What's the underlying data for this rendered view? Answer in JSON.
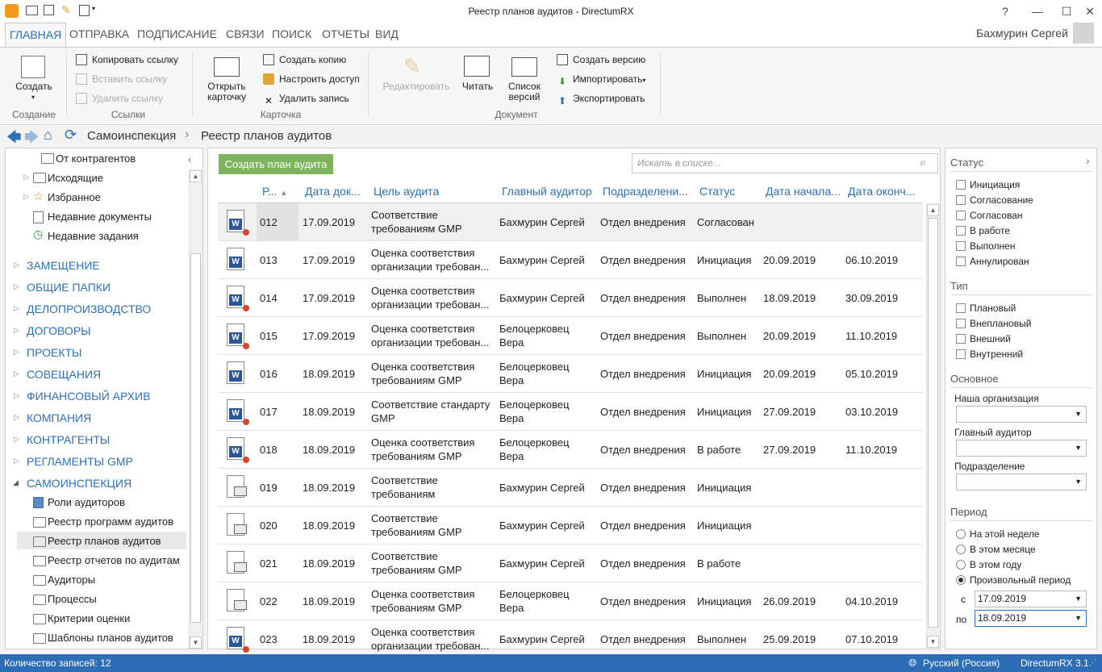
{
  "window": {
    "title": "Реестр планов аудитов - DirectumRX",
    "help": "?",
    "minimize": "—",
    "maximize": "☐",
    "close": "✕"
  },
  "tabs": [
    "ГЛАВНАЯ",
    "ОТПРАВКА",
    "ПОДПИСАНИЕ",
    "СВЯЗИ",
    "ПОИСК",
    "ОТЧЕТЫ",
    "ВИД"
  ],
  "user": "Бахмурин Сергей",
  "ribbon": {
    "create": "Создать",
    "copy_link": "Копировать ссылку",
    "paste_link": "Вставить ссылку",
    "delete_link": "Удалить ссылку",
    "open_card_1": "Открыть",
    "open_card_2": "карточку",
    "create_copy": "Создать копию",
    "setup_access": "Настроить доступ",
    "delete_record": "Удалить запись",
    "edit": "Редактировать",
    "read": "Читать",
    "versions_1": "Список",
    "versions_2": "версий",
    "create_version": "Создать версию",
    "import": "Импортировать",
    "export": "Экспортировать",
    "groups": {
      "creation": "Создание",
      "links": "Ссылки",
      "card": "Карточка",
      "document": "Документ"
    }
  },
  "breadcrumb": {
    "root": "Самоинспекция",
    "sep": "›",
    "current": "Реестр планов аудитов"
  },
  "left": {
    "items_top": [
      "От контрагентов",
      "Исходящие",
      "Избранное",
      "Недавние документы",
      "Недавние задания"
    ],
    "sections": [
      "ЗАМЕЩЕНИЕ",
      "ОБЩИЕ ПАПКИ",
      "ДЕЛОПРОИЗВОДСТВО",
      "ДОГОВОРЫ",
      "ПРОЕКТЫ",
      "СОВЕЩАНИЯ",
      "ФИНАНСОВЫЙ АРХИВ",
      "КОМПАНИЯ",
      "КОНТРАГЕНТЫ",
      "РЕГЛАМЕНТЫ GMP",
      "САМОИНСПЕКЦИЯ"
    ],
    "sub": [
      "Роли аудиторов",
      "Реестр программ аудитов",
      "Реестр планов аудитов",
      "Реестр отчетов по аудитам",
      "Аудиторы",
      "Процессы",
      "Критерии оценки",
      "Шаблоны планов аудитов"
    ]
  },
  "toolbar": {
    "create_plan": "Создать план аудита",
    "search_placeholder": "Искать в списке..."
  },
  "columns": [
    "Р...",
    "Дата док...",
    "Цель аудита",
    "Главный аудитор",
    "Подразделени...",
    "Статус",
    "Дата начала...",
    "Дата оконч..."
  ],
  "rows": [
    {
      "num": "012",
      "date": "17.09.2019",
      "goal1": "Соответствие",
      "goal2": "требованиям GMP",
      "aud1": "Бахмурин Сергей",
      "aud2": "",
      "dept": "Отдел внедрения",
      "status": "Согласован",
      "start": "",
      "end": "",
      "icon": "word-red"
    },
    {
      "num": "013",
      "date": "17.09.2019",
      "goal1": "Оценка соответствия",
      "goal2": "организации требован...",
      "aud1": "Бахмурин Сергей",
      "aud2": "",
      "dept": "Отдел внедрения",
      "status": "Инициация",
      "start": "20.09.2019",
      "end": "06.10.2019",
      "icon": "word"
    },
    {
      "num": "014",
      "date": "17.09.2019",
      "goal1": "Оценка соответствия",
      "goal2": "организации требован...",
      "aud1": "Бахмурин Сергей",
      "aud2": "",
      "dept": "Отдел внедрения",
      "status": "Выполнен",
      "start": "18.09.2019",
      "end": "30.09.2019",
      "icon": "word-red"
    },
    {
      "num": "015",
      "date": "17.09.2019",
      "goal1": "Оценка соответствия",
      "goal2": "организации требован...",
      "aud1": "Белоцерковец",
      "aud2": "Вера",
      "dept": "Отдел внедрения",
      "status": "Выполнен",
      "start": "20.09.2019",
      "end": "11.10.2019",
      "icon": "word-red"
    },
    {
      "num": "016",
      "date": "18.09.2019",
      "goal1": "Оценка соответствия",
      "goal2": "требованиям GMP",
      "aud1": "Белоцерковец",
      "aud2": "Вера",
      "dept": "Отдел внедрения",
      "status": "Инициация",
      "start": "20.09.2019",
      "end": "05.10.2019",
      "icon": "word"
    },
    {
      "num": "017",
      "date": "18.09.2019",
      "goal1": "Соответствие стандарту",
      "goal2": "GMP",
      "aud1": "Белоцерковец",
      "aud2": "Вера",
      "dept": "Отдел внедрения",
      "status": "Инициация",
      "start": "27.09.2019",
      "end": "03.10.2019",
      "icon": "word-red"
    },
    {
      "num": "018",
      "date": "18.09.2019",
      "goal1": "Оценка соответствия",
      "goal2": "требованиям GMP",
      "aud1": "Белоцерковец",
      "aud2": "Вера",
      "dept": "Отдел внедрения",
      "status": "В работе",
      "start": "27.09.2019",
      "end": "11.10.2019",
      "icon": "word-red"
    },
    {
      "num": "019",
      "date": "18.09.2019",
      "goal1": "Соответствие",
      "goal2": "требованиям",
      "aud1": "Бахмурин Сергей",
      "aud2": "",
      "dept": "Отдел внедрения",
      "status": "Инициация",
      "start": "",
      "end": "",
      "icon": "doc"
    },
    {
      "num": "020",
      "date": "18.09.2019",
      "goal1": "Соответствие",
      "goal2": "требованиям GMP",
      "aud1": "Бахмурин Сергей",
      "aud2": "",
      "dept": "Отдел внедрения",
      "status": "Инициация",
      "start": "",
      "end": "",
      "icon": "doc"
    },
    {
      "num": "021",
      "date": "18.09.2019",
      "goal1": "Соответствие",
      "goal2": "требованиям GMP",
      "aud1": "Бахмурин Сергей",
      "aud2": "",
      "dept": "Отдел внедрения",
      "status": "В работе",
      "start": "",
      "end": "",
      "icon": "doc"
    },
    {
      "num": "022",
      "date": "18.09.2019",
      "goal1": "Оценка соответствия",
      "goal2": "требованиям GMP",
      "aud1": "Белоцерковец",
      "aud2": "Вера",
      "dept": "Отдел внедрения",
      "status": "Инициация",
      "start": "26.09.2019",
      "end": "04.10.2019",
      "icon": "doc"
    },
    {
      "num": "023",
      "date": "18.09.2019",
      "goal1": "Оценка соответствия",
      "goal2": "организации требован...",
      "aud1": "Бахмурин Сергей",
      "aud2": "",
      "dept": "Отдел внедрения",
      "status": "Выполнен",
      "start": "25.09.2019",
      "end": "07.10.2019",
      "icon": "word-red"
    }
  ],
  "filters": {
    "status_title": "Статус",
    "status": [
      "Инициация",
      "Согласование",
      "Согласован",
      "В работе",
      "Выполнен",
      "Аннулирован"
    ],
    "type_title": "Тип",
    "types": [
      "Плановый",
      "Внеплановый",
      "Внешний",
      "Внутренний"
    ],
    "main_title": "Основное",
    "org_label": "Наша организация",
    "auditor_label": "Главный аудитор",
    "dept_label": "Подразделение",
    "period_title": "Период",
    "periods": [
      "На этой неделе",
      "В этом месяце",
      "В этом году",
      "Произвольный период"
    ],
    "selected_period": 3,
    "from_label": "с",
    "from_value": "17.09.2019",
    "to_label": "по",
    "to_value": "18.09.2019"
  },
  "statusbar": {
    "count": "Количество записей: 12",
    "lang": "Русский (Россия)",
    "version": "DirectumRX 3.1"
  },
  "colors": {
    "accent": "#2b70b8",
    "green_button": "#7fb45e",
    "statusbar": "#2d6db5"
  }
}
